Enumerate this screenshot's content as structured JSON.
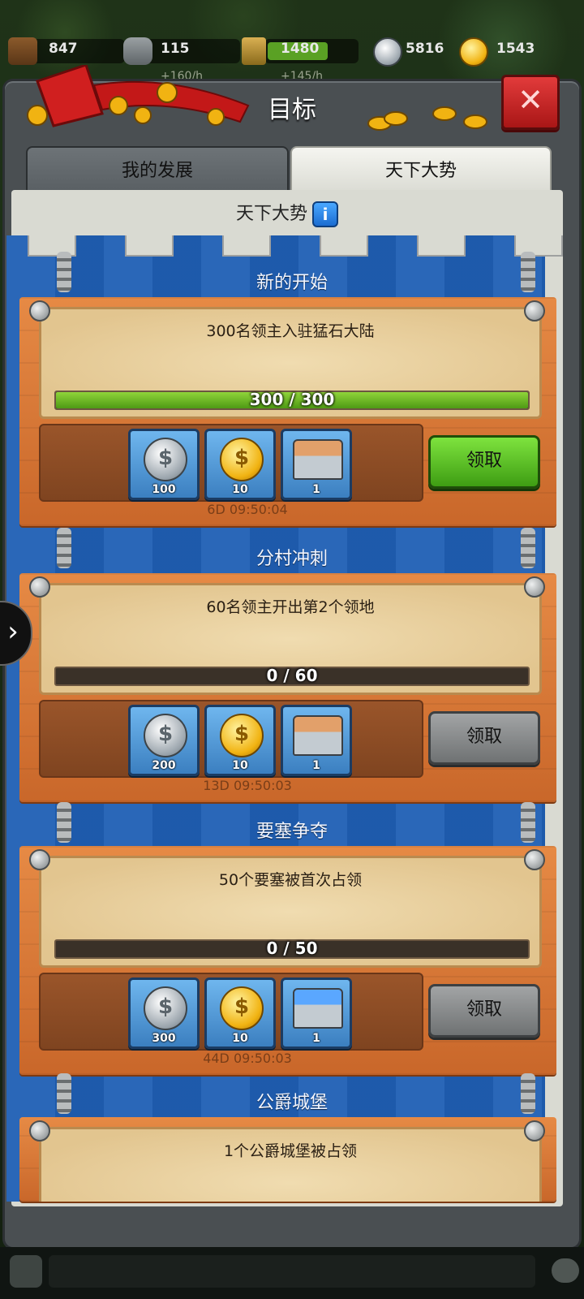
{
  "resources": [
    {
      "name": "wood",
      "value": "847",
      "rate": ""
    },
    {
      "name": "stone",
      "value": "115",
      "rate": "+160/h"
    },
    {
      "name": "food",
      "value": "1480",
      "rate": "+145/h"
    },
    {
      "name": "silver",
      "value": "5816",
      "rate": ""
    },
    {
      "name": "gold",
      "value": "1543",
      "rate": ""
    }
  ],
  "panel": {
    "title": "目标",
    "close_icon": "close-icon"
  },
  "tabs": [
    {
      "label": "我的发展",
      "active": false
    },
    {
      "label": "天下大势",
      "active": true
    }
  ],
  "header": {
    "label": "天下大势",
    "info_icon": "info-icon"
  },
  "sections": [
    {
      "title": "新的开始",
      "goal": "300名领主入驻猛石大陆",
      "progress_label": "300 / 300",
      "progress": 1.0,
      "rewards": [
        {
          "type": "silver-coin",
          "amount": "100"
        },
        {
          "type": "gold-coin",
          "amount": "10"
        },
        {
          "type": "chest-orange",
          "amount": "1"
        }
      ],
      "claim_label": "领取",
      "claim_enabled": true,
      "timer": "6D 09:50:04"
    },
    {
      "title": "分村冲刺",
      "goal": "60名领主开出第2个领地",
      "progress_label": "0 / 60",
      "progress": 0.0,
      "rewards": [
        {
          "type": "silver-coin",
          "amount": "200"
        },
        {
          "type": "gold-coin",
          "amount": "10"
        },
        {
          "type": "chest-orange",
          "amount": "1"
        }
      ],
      "claim_label": "领取",
      "claim_enabled": false,
      "timer": "13D 09:50:03"
    },
    {
      "title": "要塞争夺",
      "goal": "50个要塞被首次占领",
      "progress_label": "0 / 50",
      "progress": 0.0,
      "rewards": [
        {
          "type": "silver-coin",
          "amount": "300"
        },
        {
          "type": "gold-coin",
          "amount": "10"
        },
        {
          "type": "chest-blue",
          "amount": "1"
        }
      ],
      "claim_label": "领取",
      "claim_enabled": false,
      "timer": "44D 09:50:03"
    },
    {
      "title": "公爵城堡",
      "goal": "1个公爵城堡被占领",
      "progress_label": "",
      "progress": 0.0,
      "rewards": [],
      "claim_label": "",
      "claim_enabled": false,
      "timer": ""
    }
  ],
  "colors": {
    "wall_blue": "#1f5fb4",
    "board_orange": "#e68a45",
    "claim_green": "#4e9a14",
    "claim_gray": "#6f7273",
    "progress_green": "#8fd43a"
  }
}
